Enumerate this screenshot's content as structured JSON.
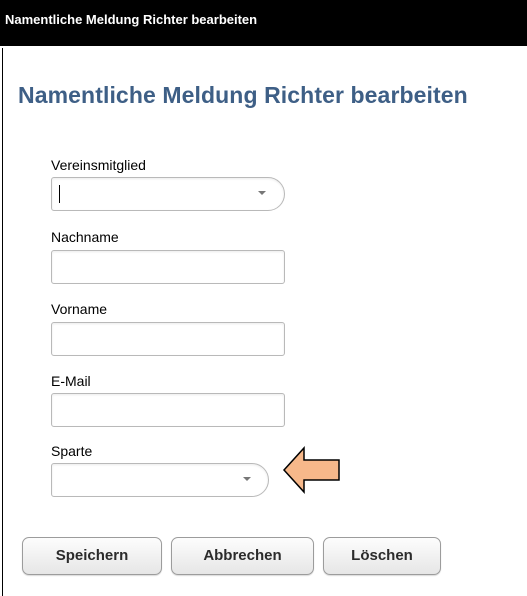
{
  "window": {
    "title": "Namentliche Meldung Richter bearbeiten"
  },
  "form": {
    "heading": "Namentliche Meldung Richter bearbeiten",
    "fields": {
      "vereinsmitglied": {
        "label": "Vereinsmitglied",
        "value": ""
      },
      "nachname": {
        "label": "Nachname",
        "value": ""
      },
      "vorname": {
        "label": "Vorname",
        "value": ""
      },
      "email": {
        "label": "E-Mail",
        "value": ""
      },
      "sparte": {
        "label": "Sparte",
        "value": ""
      }
    }
  },
  "buttons": {
    "save": "Speichern",
    "cancel": "Abbrechen",
    "delete": "Löschen"
  },
  "annotation": {
    "icon": "left-arrow",
    "fill": "#f7b88a",
    "stroke": "#000000"
  }
}
